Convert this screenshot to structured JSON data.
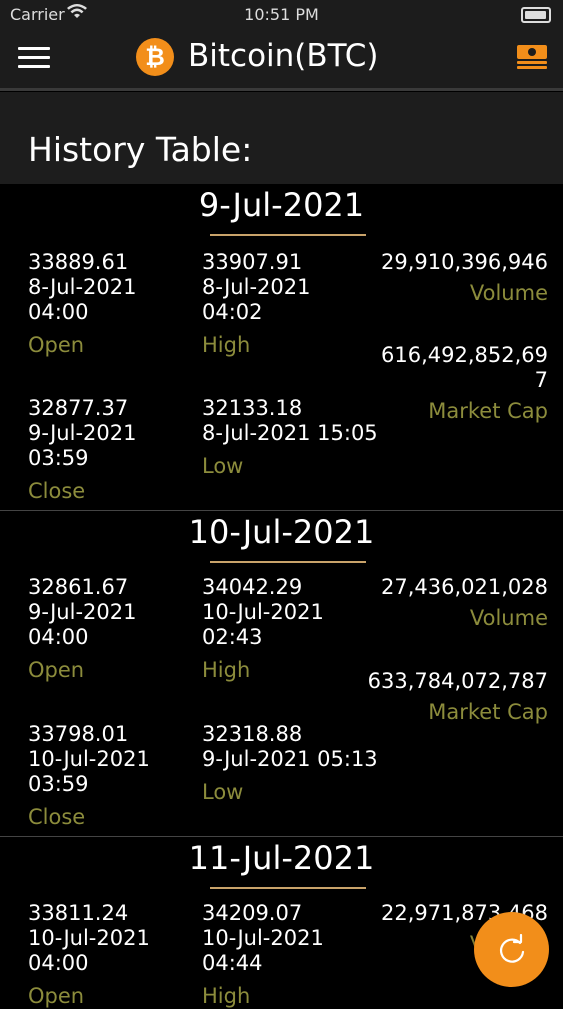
{
  "status": {
    "carrier": "Carrier",
    "time": "10:51 PM"
  },
  "nav": {
    "title": "Bitcoin(BTC)",
    "logo_symbol": "₿"
  },
  "section": {
    "title": "History Table:"
  },
  "labels": {
    "open": "Open",
    "high": "High",
    "close": "Close",
    "low": "Low",
    "volume": "Volume",
    "market_cap": "Market Cap"
  },
  "colors": {
    "accent": "#f28e1a",
    "label": "#8c8c3c",
    "underline": "#c9a36a"
  },
  "days": [
    {
      "date": "9-Jul-2021",
      "open": {
        "value": "33889.61",
        "date": "8-Jul-2021",
        "time": "04:00"
      },
      "high": {
        "value": "33907.91",
        "date": "8-Jul-2021",
        "time": "04:02"
      },
      "close": {
        "value": "32877.37",
        "date": "9-Jul-2021",
        "time": "03:59"
      },
      "low": {
        "value": "32133.18",
        "datetime": "8-Jul-2021 15:05"
      },
      "volume": "29,910,396,946",
      "market_cap_line1": "616,492,852,69",
      "market_cap_line2": "7"
    },
    {
      "date": "10-Jul-2021",
      "open": {
        "value": "32861.67",
        "date": "9-Jul-2021",
        "time": "04:00"
      },
      "high": {
        "value": "34042.29",
        "date": "10-Jul-2021",
        "time": "02:43"
      },
      "close": {
        "value": "33798.01",
        "date": "10-Jul-2021",
        "time": "03:59"
      },
      "low": {
        "value": "32318.88",
        "datetime": "9-Jul-2021 05:13"
      },
      "volume": "27,436,021,028",
      "market_cap_line1": "633,784,072,787",
      "market_cap_line2": ""
    },
    {
      "date": "11-Jul-2021",
      "open": {
        "value": "33811.24",
        "date": "10-Jul-2021",
        "time": "04:00"
      },
      "high": {
        "value": "34209.07",
        "date": "10-Jul-2021",
        "time": "04:44"
      },
      "volume": "22,971,873,468"
    }
  ]
}
